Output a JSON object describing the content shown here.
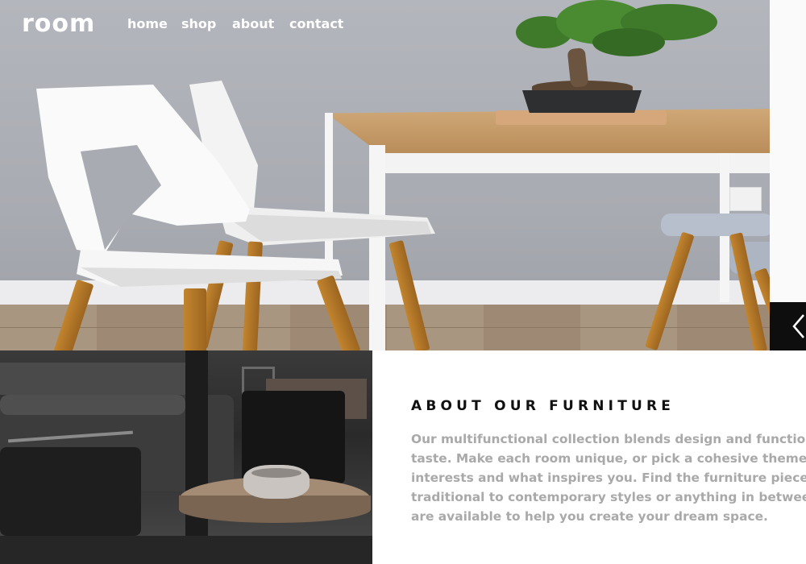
{
  "brand": {
    "logo": "room"
  },
  "nav": {
    "items": [
      {
        "label": "home"
      },
      {
        "label": "shop"
      },
      {
        "label": "about"
      },
      {
        "label": "contact"
      }
    ]
  },
  "hero": {
    "arrow_icon": "chevron-left-icon"
  },
  "about": {
    "title": "ABOUT OUR FURNITURE",
    "lines": [
      "Our multifunctional collection blends design and function to s",
      "taste. Make each room unique, or pick a cohesive theme that",
      "interests and what inspires you. Find the furniture pieces you",
      "traditional to contemporary styles or anything in between. Pr",
      "are available to help you create your dream space."
    ]
  },
  "colors": {
    "accent_dark": "#0e0e0e",
    "text_muted": "#a9a9a9",
    "heading": "#111111"
  }
}
